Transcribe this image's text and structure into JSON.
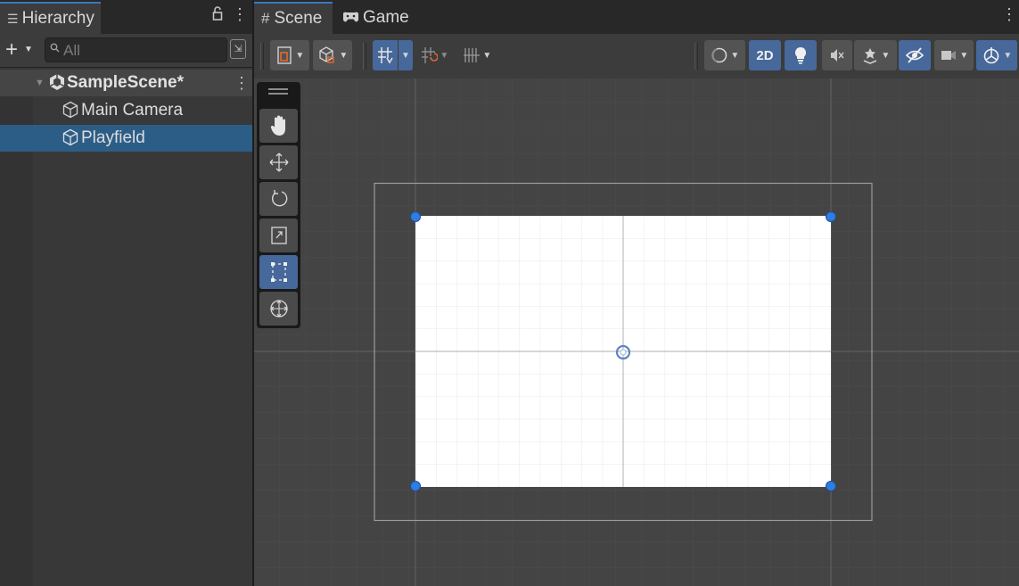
{
  "hierarchy": {
    "tab_label": "Hierarchy",
    "search_placeholder": "All",
    "scene_name": "SampleScene*",
    "items": [
      {
        "label": "Main Camera",
        "icon": "cube-icon",
        "selected": false
      },
      {
        "label": "Playfield",
        "icon": "cube-icon",
        "selected": true
      }
    ]
  },
  "scene_view": {
    "tabs": [
      {
        "label": "Scene",
        "icon": "hash-icon",
        "active": true
      },
      {
        "label": "Game",
        "icon": "gamepad-icon",
        "active": false
      }
    ],
    "toolbar": {
      "toggle_2d_label": "2D",
      "active_buttons": [
        "grid-snap",
        "2d-mode",
        "lighting",
        "hide-effects",
        "gizmos"
      ]
    },
    "tools": [
      {
        "name": "hand-tool",
        "active": false
      },
      {
        "name": "move-tool",
        "active": false
      },
      {
        "name": "rotate-tool",
        "active": false
      },
      {
        "name": "scale-tool",
        "active": false
      },
      {
        "name": "rect-tool",
        "active": true
      },
      {
        "name": "transform-tool",
        "active": false
      }
    ],
    "colors": {
      "accent": "#3a79bb",
      "selection": "#2c5d87",
      "active_button": "#47689a",
      "playfield": "#ffffff",
      "rect_handle": "#2f7de0"
    }
  }
}
